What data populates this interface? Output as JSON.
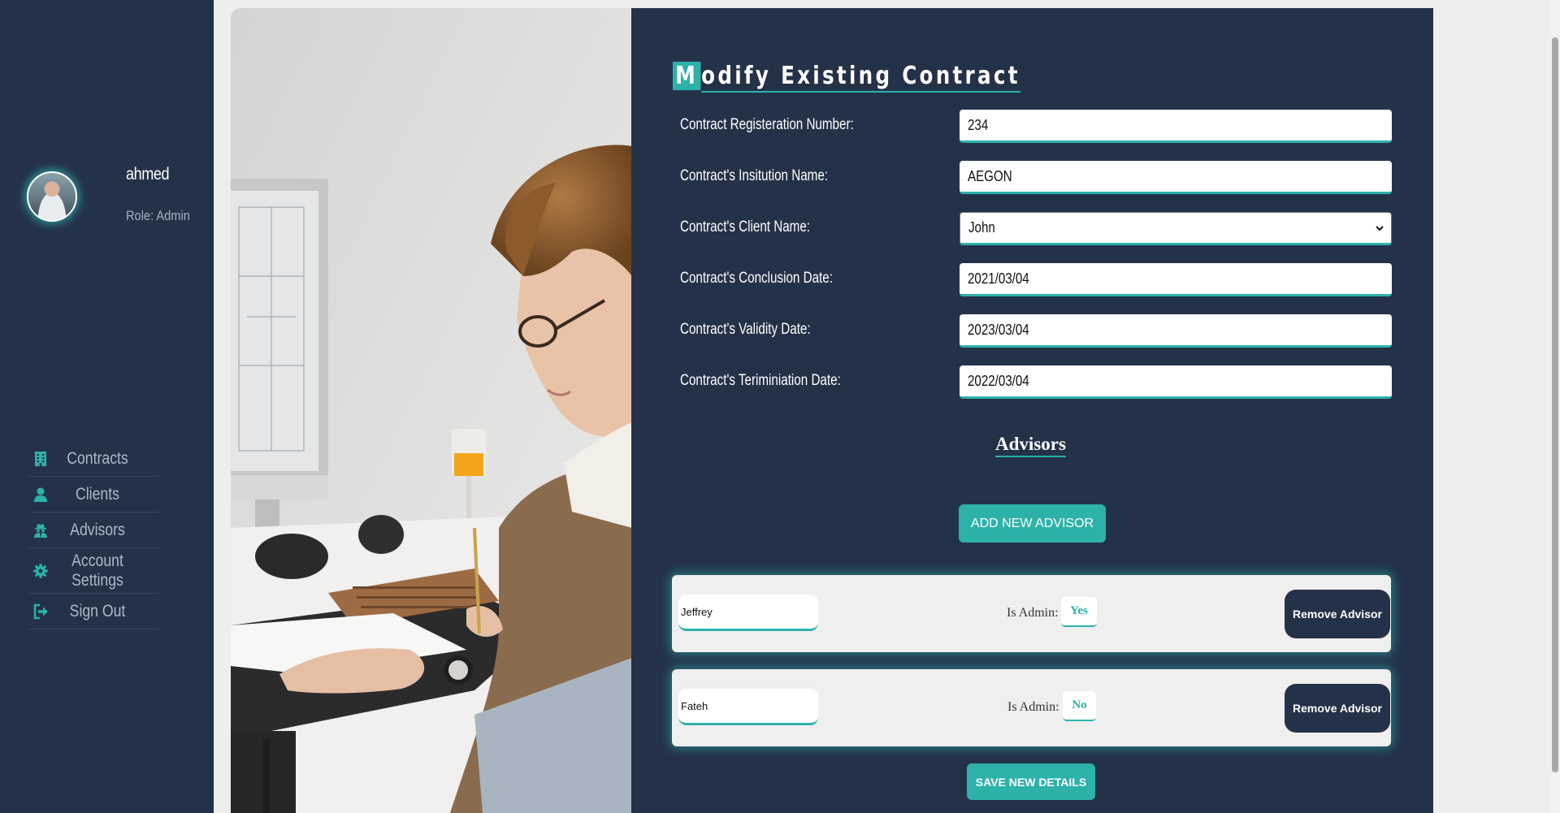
{
  "sidebar": {
    "user": {
      "name": "ahmed",
      "role": "Role: Admin"
    },
    "nav": [
      {
        "label": "Contracts",
        "icon": "building-icon"
      },
      {
        "label": "Clients",
        "icon": "user-icon"
      },
      {
        "label": "Advisors",
        "icon": "user-secret-icon"
      },
      {
        "label": "Account Settings",
        "icon": "gear-icon"
      },
      {
        "label": "Sign Out",
        "icon": "sign-out-icon"
      }
    ]
  },
  "form": {
    "title_first": "M",
    "title_rest": "odify Existing Contract",
    "fields": [
      {
        "label": "Contract Registeration Number:",
        "value": "234"
      },
      {
        "label": "Contract's Insitution Name:",
        "value": "AEGON"
      },
      {
        "label": "Contract's Client Name:",
        "value": "John"
      },
      {
        "label": "Contract's Conclusion Date:",
        "value": "2021/03/04"
      },
      {
        "label": "Contract's Validity Date:",
        "value": "2023/03/04"
      },
      {
        "label": "Contract's Teriminiation Date:",
        "value": "2022/03/04"
      }
    ]
  },
  "advisors": {
    "title": "Advisors",
    "add_label": "ADD NEW ADVISOR",
    "list": [
      {
        "name": "Jeffrey",
        "is_admin_label": "Is Admin:",
        "is_admin": "Yes",
        "remove_label": "Remove Advisor"
      },
      {
        "name": "Fateh",
        "is_admin_label": "Is Admin:",
        "is_admin": "No",
        "remove_label": "Remove Advisor"
      }
    ]
  },
  "save_label": "SAVE NEW DETAILS",
  "colors": {
    "accent": "#2db2aa",
    "navy": "#243249",
    "nav_text": "#aeb8c5"
  }
}
